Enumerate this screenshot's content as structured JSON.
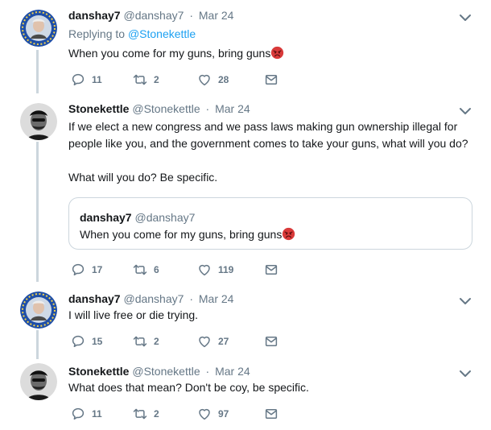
{
  "colors": {
    "text": "#14171a",
    "muted": "#657786",
    "link": "#1da1f2",
    "border": "#ccd6dd"
  },
  "tweets": [
    {
      "name": "danshay7",
      "handle": "@danshay7",
      "sep": "·",
      "time": "Mar 24",
      "reply_prefix": "Replying to",
      "reply_handle": "@Stonekettle",
      "text": "When you come for my guns, bring guns",
      "emoji": "angry-face-emoji",
      "replies": "11",
      "retweets": "2",
      "likes": "28"
    },
    {
      "name": "Stonekettle",
      "handle": "@Stonekettle",
      "sep": "·",
      "time": "Mar 24",
      "text": "If we elect a new congress and we pass laws making gun ownership illegal for people like you, and the government comes to take your guns, what will you do?\n\nWhat will you do? Be specific.",
      "quote": {
        "name": "danshay7",
        "handle": "@danshay7",
        "text": "When you come for my guns, bring guns",
        "emoji": "angry-face-emoji"
      },
      "replies": "17",
      "retweets": "6",
      "likes": "119"
    },
    {
      "name": "danshay7",
      "handle": "@danshay7",
      "sep": "·",
      "time": "Mar 24",
      "text": "I will live free or die trying.",
      "replies": "15",
      "retweets": "2",
      "likes": "27"
    },
    {
      "name": "Stonekettle",
      "handle": "@Stonekettle",
      "sep": "·",
      "time": "Mar 24",
      "text": "What does that mean? Don't be coy, be specific.",
      "replies": "11",
      "retweets": "2",
      "likes": "97"
    }
  ]
}
